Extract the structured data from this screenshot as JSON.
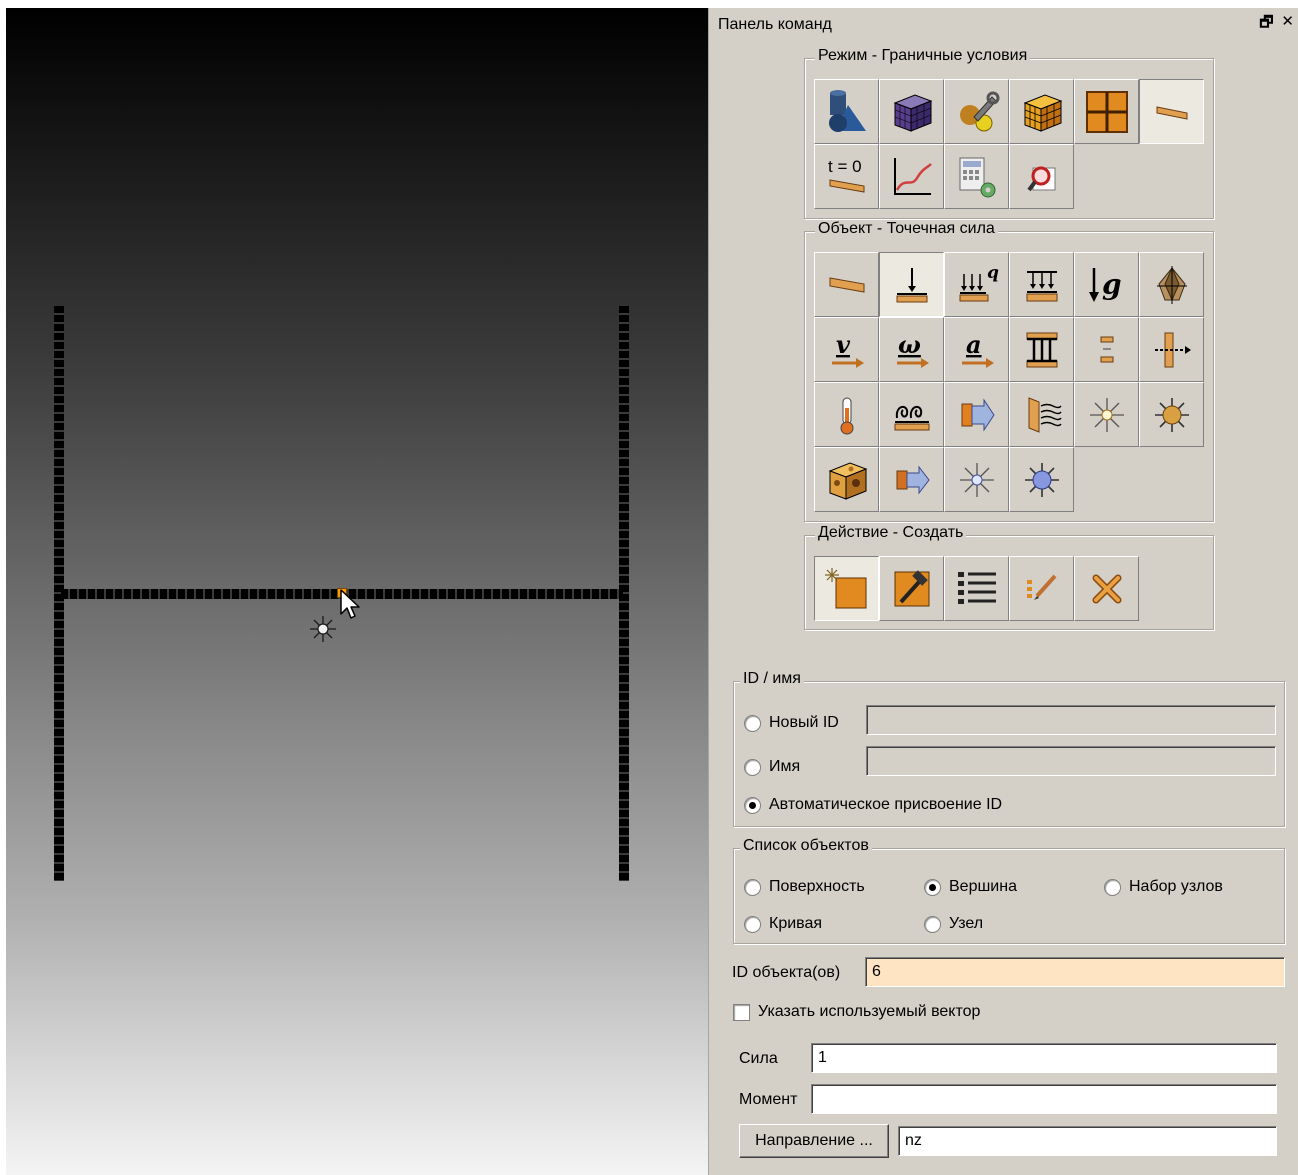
{
  "panel": {
    "title": "Панель команд",
    "float_icon": "🗗",
    "close_icon": "✕"
  },
  "mode_group": {
    "label": "Режим - Граничные условия",
    "buttons": [
      {
        "name": "geometry-mode",
        "icon": "geometry-icon"
      },
      {
        "name": "mesh-mode",
        "icon": "mesh-cube-icon"
      },
      {
        "name": "materials-tools-mode",
        "icon": "wrench-materials-icon"
      },
      {
        "name": "blocks-mode",
        "icon": "orange-cube-icon"
      },
      {
        "name": "groups-mode",
        "icon": "orange-grid-icon"
      },
      {
        "name": "boundary-conditions-mode",
        "icon": "beam-bc-icon",
        "active": true
      },
      {
        "name": "initial-conditions-mode",
        "icon": "t-zero-icon",
        "text": "t = 0"
      },
      {
        "name": "graphs-mode",
        "icon": "curve-graph-icon"
      },
      {
        "name": "calculator-mode",
        "icon": "calculator-gear-icon"
      },
      {
        "name": "inspect-mode",
        "icon": "magnifier-icon"
      }
    ]
  },
  "object_group": {
    "label": "Объект - Точечная сила",
    "buttons": [
      {
        "name": "displacement",
        "icon": "beam-support-icon"
      },
      {
        "name": "point-force",
        "icon": "point-force-icon",
        "active": true
      },
      {
        "name": "distributed-load",
        "icon": "distributed-load-q-icon",
        "text": "q"
      },
      {
        "name": "pressure",
        "icon": "pressure-icon"
      },
      {
        "name": "gravity",
        "icon": "gravity-g-icon",
        "text": "g"
      },
      {
        "name": "acceleration-body",
        "icon": "body-acceleration-icon"
      },
      {
        "name": "velocity",
        "icon": "velocity-v-icon",
        "text": "v"
      },
      {
        "name": "angular-velocity",
        "icon": "angular-velocity-omega-icon",
        "text": "ω"
      },
      {
        "name": "acceleration",
        "icon": "acceleration-a-icon",
        "text": "a"
      },
      {
        "name": "constraint",
        "icon": "column-constraint-icon"
      },
      {
        "name": "contact-gap",
        "icon": "gap-icon"
      },
      {
        "name": "coupling",
        "icon": "coupling-arrow-icon"
      },
      {
        "name": "temperature",
        "icon": "thermometer-icon"
      },
      {
        "name": "convection",
        "icon": "convection-icon"
      },
      {
        "name": "heat-flux",
        "icon": "heat-flux-icon"
      },
      {
        "name": "radiation",
        "icon": "radiation-wall-icon"
      },
      {
        "name": "light-source",
        "icon": "sun-outline-icon"
      },
      {
        "name": "heat-source",
        "icon": "sun-filled-icon"
      },
      {
        "name": "volume-heat",
        "icon": "cheese-block-icon"
      },
      {
        "name": "heat-transfer",
        "icon": "transfer-arrow-icon"
      },
      {
        "name": "point-light",
        "icon": "sun-blue-outline-icon"
      },
      {
        "name": "point-heat",
        "icon": "sun-blue-filled-icon"
      }
    ]
  },
  "action_group": {
    "label": "Действие - Создать",
    "buttons": [
      {
        "name": "create",
        "icon": "create-star-icon",
        "active": true
      },
      {
        "name": "modify",
        "icon": "hammer-icon"
      },
      {
        "name": "list",
        "icon": "list-icon"
      },
      {
        "name": "edit",
        "icon": "pencil-list-icon"
      },
      {
        "name": "delete",
        "icon": "delete-cross-icon"
      }
    ]
  },
  "id_group": {
    "label": "ID / имя",
    "new_id_label": "Новый ID",
    "name_label": "Имя",
    "auto_label": "Автоматическое присвоение ID",
    "selected": "auto"
  },
  "objects_group": {
    "label": "Список объектов",
    "options": [
      "Поверхность",
      "Вершина",
      "Набор узлов",
      "Кривая",
      "Узел"
    ],
    "selected": "Вершина"
  },
  "object_ids": {
    "label": "ID объекта(ов)",
    "value": "6"
  },
  "vector_checkbox": {
    "label": "Указать используемый вектор",
    "checked": false
  },
  "force": {
    "label": "Сила",
    "value": "1"
  },
  "moment": {
    "label": "Момент",
    "value": ""
  },
  "direction": {
    "button_label": "Направление ...",
    "value": "nz"
  }
}
